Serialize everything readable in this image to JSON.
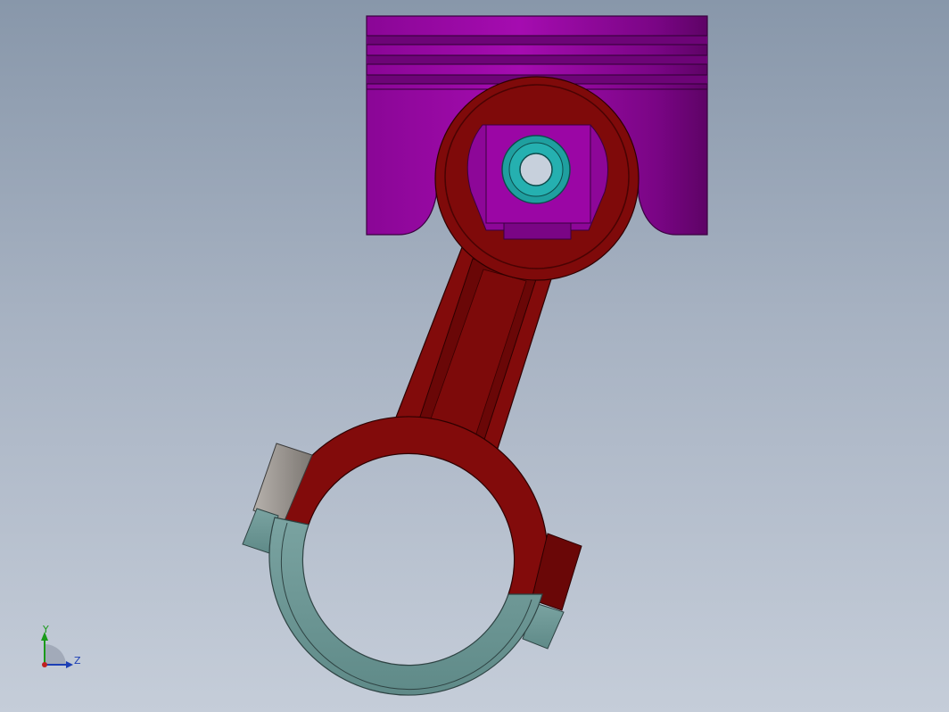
{
  "viewport": {
    "background_top": "#8897aa",
    "background_bottom": "#c5cdd9"
  },
  "model": {
    "parts": [
      {
        "name": "piston",
        "color": "#9b06a5"
      },
      {
        "name": "connecting-rod",
        "color": "#7f0a0a"
      },
      {
        "name": "rod-bearing-cap",
        "color": "#6f9a98"
      },
      {
        "name": "piston-pin",
        "color": "#1aa3a3"
      }
    ]
  },
  "triad": {
    "y_label": "Y",
    "z_label": "Z",
    "y_color": "#1a9a1a",
    "z_color": "#1c3fb5",
    "origin_color": "#c02020"
  }
}
